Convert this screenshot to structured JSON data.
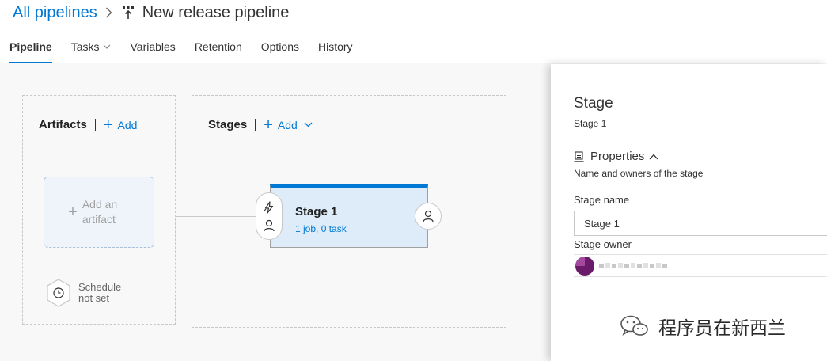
{
  "header": {
    "breadcrumb_link": "All pipelines",
    "pipeline_title": "New release pipeline"
  },
  "tabs": [
    {
      "label": "Pipeline",
      "active": true
    },
    {
      "label": "Tasks",
      "active": false,
      "has_dropdown": true
    },
    {
      "label": "Variables",
      "active": false
    },
    {
      "label": "Retention",
      "active": false
    },
    {
      "label": "Options",
      "active": false
    },
    {
      "label": "History",
      "active": false
    }
  ],
  "artifacts": {
    "title": "Artifacts",
    "add_label": "Add",
    "add_artifact_label": "Add an artifact",
    "schedule_label": "Schedule not set"
  },
  "stages": {
    "title": "Stages",
    "add_label": "Add",
    "stage_card": {
      "name": "Stage 1",
      "summary": "1 job, 0 task"
    }
  },
  "panel": {
    "title": "Stage",
    "subtitle": "Stage 1",
    "properties_label": "Properties",
    "properties_desc": "Name and owners of the stage",
    "stage_name_label": "Stage name",
    "stage_name_value": "Stage 1",
    "stage_owner_label": "Stage owner"
  },
  "watermark": {
    "text": "程序员在新西兰"
  },
  "colors": {
    "accent": "#0078d4",
    "stage_bg": "#deecf9",
    "canvas_bg": "#f8f8f8"
  }
}
